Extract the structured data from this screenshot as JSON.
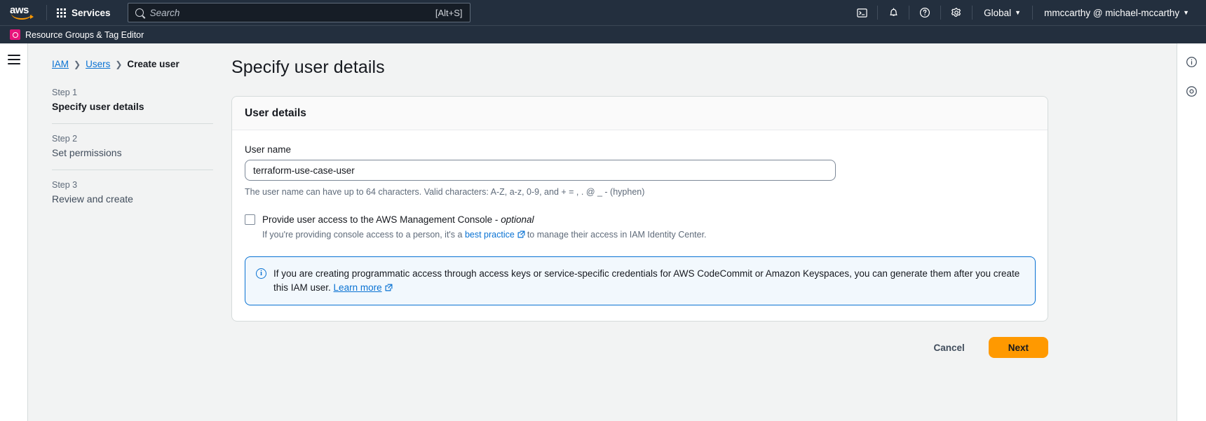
{
  "topnav": {
    "logo_text": "aws",
    "services_label": "Services",
    "search": {
      "placeholder": "Search",
      "value": "",
      "shortcut_hint": "[Alt+S]",
      "icon": "search-icon"
    },
    "icons": [
      {
        "name": "cloudshell-icon",
        "glyph": "terminal"
      },
      {
        "name": "notifications-icon",
        "glyph": "bell"
      },
      {
        "name": "help-icon",
        "glyph": "question-circle"
      },
      {
        "name": "settings-icon",
        "glyph": "gear"
      }
    ],
    "region_label": "Global",
    "account_label": "mmccarthy @ michael-mccarthy"
  },
  "subnav": {
    "item_label": "Resource Groups & Tag Editor",
    "icon": "resource-groups-icon",
    "icon_color": "#e7157b"
  },
  "breadcrumb": [
    {
      "label": "IAM",
      "link": true
    },
    {
      "label": "Users",
      "link": true
    },
    {
      "label": "Create user",
      "link": false
    }
  ],
  "wizard": {
    "steps": [
      {
        "number": "Step 1",
        "name": "Specify user details",
        "active": true
      },
      {
        "number": "Step 2",
        "name": "Set permissions",
        "active": false
      },
      {
        "number": "Step 3",
        "name": "Review and create",
        "active": false
      }
    ]
  },
  "main": {
    "page_title": "Specify user details",
    "card_title": "User details",
    "user_name": {
      "label": "User name",
      "value": "terraform-use-case-user",
      "placeholder": "",
      "constraint": "The user name can have up to 64 characters. Valid characters: A-Z, a-z, 0-9, and + = , . @ _ - (hyphen)"
    },
    "console_access": {
      "checked": false,
      "label_main": "Provide user access to the AWS Management Console -",
      "label_optional": "optional",
      "desc_pre": "If you're providing console access to a person, it's a ",
      "desc_link": "best practice",
      "desc_post": "to manage their access in IAM Identity Center."
    },
    "alert": {
      "icon": "info-icon",
      "text": "If you are creating programmatic access through access keys or service-specific credentials for AWS CodeCommit or Amazon Keyspaces, you can generate them after you create this IAM user.",
      "link": "Learn more",
      "border_color": "#0972d3",
      "background_color": "#f2f8fd"
    },
    "actions": {
      "cancel_label": "Cancel",
      "next_label": "Next",
      "next_color": "#ff9900"
    }
  },
  "right_rail": [
    {
      "name": "info-panel-icon"
    },
    {
      "name": "shortcuts-icon"
    }
  ]
}
